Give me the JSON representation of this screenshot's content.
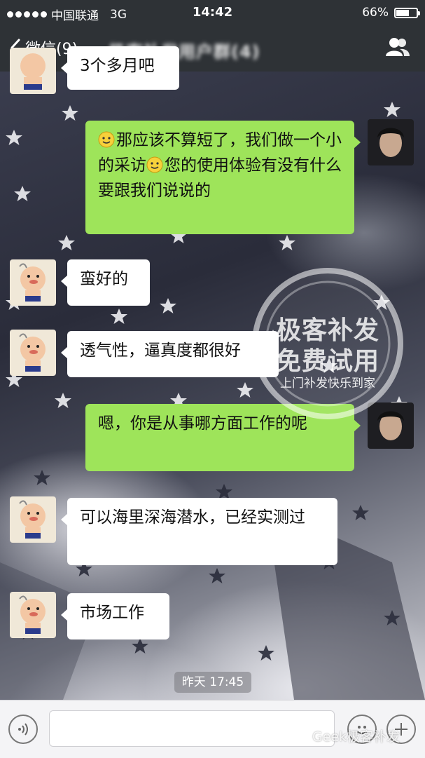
{
  "status_bar": {
    "carrier": "中国联通",
    "network": "3G",
    "time": "14:42",
    "battery": "66%",
    "battery_level": 0.66
  },
  "nav": {
    "back_label": "微信(9)",
    "title": "极客补发用户群(4)"
  },
  "messages": [
    {
      "side": "left",
      "text": "3个多月吧"
    },
    {
      "side": "right",
      "text_a": "那应该不算短了，我们做一个小的采访",
      "text_b": "您的使用体验有没有什么要跟我们说说的"
    },
    {
      "side": "left",
      "text": "蛮好的"
    },
    {
      "side": "left",
      "text": "透气性，逼真度都很好"
    },
    {
      "side": "right",
      "text": "嗯，你是从事哪方面工作的呢"
    },
    {
      "side": "left",
      "text": "可以海里深海潜水，已经实测过"
    },
    {
      "side": "left",
      "text": "市场工作"
    }
  ],
  "watermark": {
    "line1": "极客补发",
    "line2": "免费试用",
    "line3": "上门补发快乐到家",
    "footer": "Geek极客补发"
  },
  "timestamp": "昨天 17:45",
  "input": {
    "placeholder": ""
  },
  "colors": {
    "bar_bg": "#2e3236",
    "sent_bubble": "#9ee45a",
    "received_bubble": "#ffffff"
  }
}
